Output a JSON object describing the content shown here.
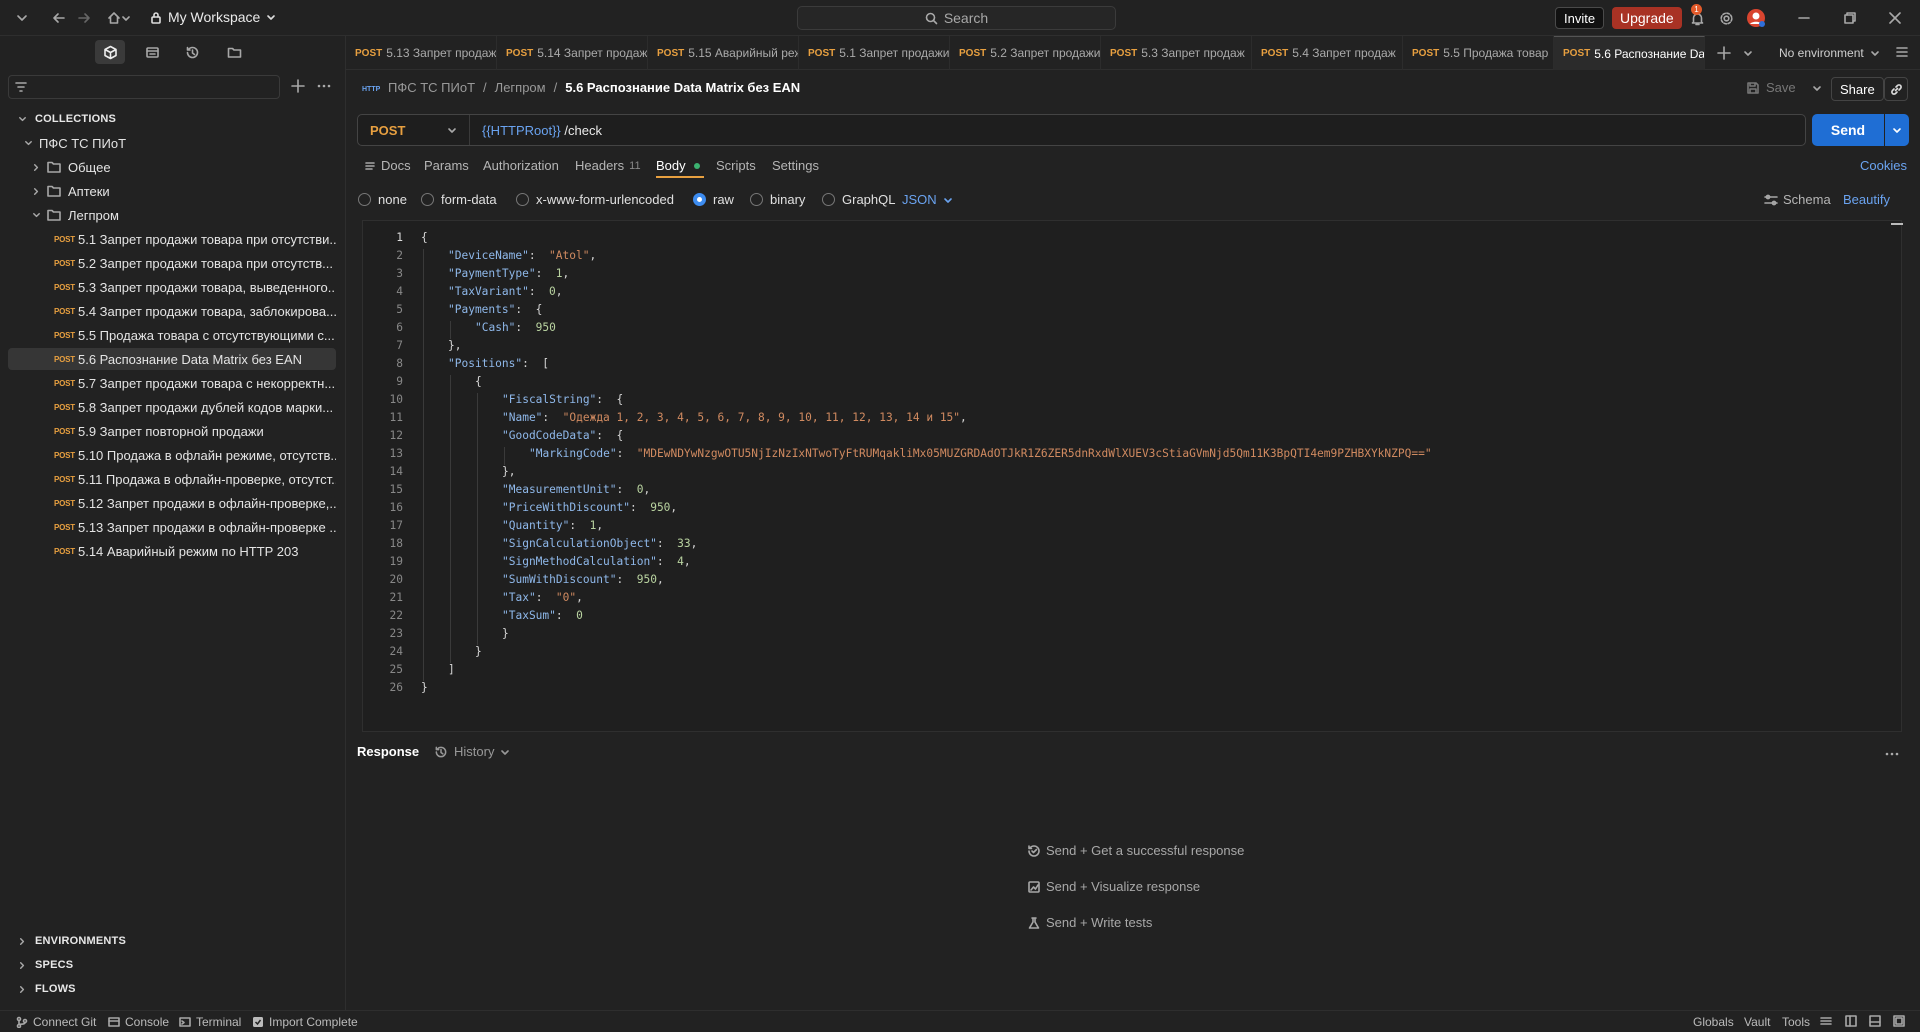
{
  "topbar": {
    "workspace": "My Workspace",
    "search_placeholder": "Search",
    "invite": "Invite",
    "upgrade": "Upgrade",
    "notification_count": "1"
  },
  "sidebar": {
    "collections_label": "COLLECTIONS",
    "collection_name": "ПФС ТС ПИоТ",
    "folders": [
      "Общее",
      "Аптеки",
      "Легпром"
    ],
    "method_tag": "POST",
    "requests": [
      "5.1 Запрет продажи товара при отсутстви...",
      "5.2 Запрет продажи товара при отсутств...",
      "5.3 Запрет продажи товара, выведенного...",
      "5.4 Запрет продажи товара, заблокирова...",
      "5.5 Продажа товара с отсутствующими с...",
      "5.6 Распознание Data Matrix без EAN",
      "5.7 Запрет продажи товара с некорректн...",
      "5.8 Запрет продажи дублей кодов марки...",
      "5.9 Запрет повторной продажи",
      "5.10 Продажа в офлайн режиме, отсутств...",
      "5.11 Продажа в офлайн-проверке, отсутст...",
      "5.12 Запрет продажи в офлайн-проверке,...",
      "5.13 Запрет продажи в офлайн-проверке ...",
      "5.14 Аварийный режим по HTTP 203"
    ],
    "bottom_sections": [
      "ENVIRONMENTS",
      "SPECS",
      "FLOWS"
    ]
  },
  "tabs": [
    {
      "method": "POST",
      "title": "5.13 Запрет продаж"
    },
    {
      "method": "POST",
      "title": "5.14 Запрет продаж"
    },
    {
      "method": "POST",
      "title": "5.15 Аварийный реж"
    },
    {
      "method": "POST",
      "title": "5.1 Запрет продажи"
    },
    {
      "method": "POST",
      "title": "5.2 Запрет продажи"
    },
    {
      "method": "POST",
      "title": "5.3 Запрет продаж"
    },
    {
      "method": "POST",
      "title": "5.4 Запрет продаж"
    },
    {
      "method": "POST",
      "title": "5.5 Продажа товар"
    },
    {
      "method": "POST",
      "title": "5.6 Распознание Da"
    }
  ],
  "environment": "No environment",
  "breadcrumb": {
    "collection": "ПФС ТС ПИоТ",
    "folder": "Легпром",
    "request": "5.6 Распознание Data Matrix без EAN"
  },
  "request": {
    "save": "Save",
    "share": "Share",
    "method": "POST",
    "url_var": "{{HTTPRoot}}",
    "url_path": " /check",
    "send": "Send"
  },
  "request_tabs": {
    "docs": "Docs",
    "params": "Params",
    "authorization": "Authorization",
    "headers": "Headers",
    "headers_count": "11",
    "body": "Body",
    "scripts": "Scripts",
    "settings": "Settings",
    "cookies": "Cookies"
  },
  "body_types": [
    "none",
    "form-data",
    "x-www-form-urlencoded",
    "raw",
    "binary",
    "GraphQL"
  ],
  "body_format": "JSON",
  "schema": "Schema",
  "beautify": "Beautify",
  "code_lines": [
    {
      "indent": 0,
      "parts": [
        [
          "p",
          "{"
        ]
      ]
    },
    {
      "indent": 1,
      "parts": [
        [
          "k",
          "\"DeviceName\""
        ],
        [
          "p",
          ":  "
        ],
        [
          "s",
          "\"Atol\""
        ],
        [
          "p",
          ","
        ]
      ]
    },
    {
      "indent": 1,
      "parts": [
        [
          "k",
          "\"PaymentType\""
        ],
        [
          "p",
          ":  "
        ],
        [
          "n",
          "1"
        ],
        [
          "p",
          ","
        ]
      ]
    },
    {
      "indent": 1,
      "parts": [
        [
          "k",
          "\"TaxVariant\""
        ],
        [
          "p",
          ":  "
        ],
        [
          "n",
          "0"
        ],
        [
          "p",
          ","
        ]
      ]
    },
    {
      "indent": 1,
      "parts": [
        [
          "k",
          "\"Payments\""
        ],
        [
          "p",
          ":  {"
        ]
      ]
    },
    {
      "indent": 2,
      "parts": [
        [
          "k",
          "\"Cash\""
        ],
        [
          "p",
          ":  "
        ],
        [
          "n",
          "950"
        ]
      ]
    },
    {
      "indent": 1,
      "parts": [
        [
          "p",
          "},"
        ]
      ]
    },
    {
      "indent": 1,
      "parts": [
        [
          "k",
          "\"Positions\""
        ],
        [
          "p",
          ":  ["
        ]
      ]
    },
    {
      "indent": 2,
      "parts": [
        [
          "p",
          "{"
        ]
      ]
    },
    {
      "indent": 3,
      "parts": [
        [
          "k",
          "\"FiscalString\""
        ],
        [
          "p",
          ":  {"
        ]
      ]
    },
    {
      "indent": 3,
      "parts": [
        [
          "k",
          "\"Name\""
        ],
        [
          "p",
          ":  "
        ],
        [
          "s",
          "\"Одежда 1, 2, 3, 4, 5, 6, 7, 8, 9, 10, 11, 12, 13, 14 и 15\""
        ],
        [
          "p",
          ","
        ]
      ]
    },
    {
      "indent": 3,
      "parts": [
        [
          "k",
          "\"GoodCodeData\""
        ],
        [
          "p",
          ":  {"
        ]
      ]
    },
    {
      "indent": 4,
      "parts": [
        [
          "k",
          "\"MarkingCode\""
        ],
        [
          "p",
          ":  "
        ],
        [
          "s",
          "\"MDEwNDYwNzgwOTU5NjIzNzIxNTwoTyFtRUMqakliMx05MUZGRDAdOTJkR1Z6ZER5dnRxdWlXUEV3cStiaGVmNjd5Qm11K3BpQTI4em9PZHBXYkNZPQ==\""
        ]
      ]
    },
    {
      "indent": 3,
      "parts": [
        [
          "p",
          "},"
        ]
      ]
    },
    {
      "indent": 3,
      "parts": [
        [
          "k",
          "\"MeasurementUnit\""
        ],
        [
          "p",
          ":  "
        ],
        [
          "n",
          "0"
        ],
        [
          "p",
          ","
        ]
      ]
    },
    {
      "indent": 3,
      "parts": [
        [
          "k",
          "\"PriceWithDiscount\""
        ],
        [
          "p",
          ":  "
        ],
        [
          "n",
          "950"
        ],
        [
          "p",
          ","
        ]
      ]
    },
    {
      "indent": 3,
      "parts": [
        [
          "k",
          "\"Quantity\""
        ],
        [
          "p",
          ":  "
        ],
        [
          "n",
          "1"
        ],
        [
          "p",
          ","
        ]
      ]
    },
    {
      "indent": 3,
      "parts": [
        [
          "k",
          "\"SignCalculationObject\""
        ],
        [
          "p",
          ":  "
        ],
        [
          "n",
          "33"
        ],
        [
          "p",
          ","
        ]
      ]
    },
    {
      "indent": 3,
      "parts": [
        [
          "k",
          "\"SignMethodCalculation\""
        ],
        [
          "p",
          ":  "
        ],
        [
          "n",
          "4"
        ],
        [
          "p",
          ","
        ]
      ]
    },
    {
      "indent": 3,
      "parts": [
        [
          "k",
          "\"SumWithDiscount\""
        ],
        [
          "p",
          ":  "
        ],
        [
          "n",
          "950"
        ],
        [
          "p",
          ","
        ]
      ]
    },
    {
      "indent": 3,
      "parts": [
        [
          "k",
          "\"Tax\""
        ],
        [
          "p",
          ":  "
        ],
        [
          "s",
          "\"0\""
        ],
        [
          "p",
          ","
        ]
      ]
    },
    {
      "indent": 3,
      "parts": [
        [
          "k",
          "\"TaxSum\""
        ],
        [
          "p",
          ":  "
        ],
        [
          "n",
          "0"
        ]
      ]
    },
    {
      "indent": 3,
      "parts": [
        [
          "p",
          "}"
        ]
      ]
    },
    {
      "indent": 2,
      "parts": [
        [
          "p",
          "}"
        ]
      ]
    },
    {
      "indent": 1,
      "parts": [
        [
          "p",
          "]"
        ]
      ]
    },
    {
      "indent": 0,
      "parts": [
        [
          "p",
          "}"
        ]
      ]
    }
  ],
  "response": {
    "title": "Response",
    "history": "History",
    "hints": [
      "Send + Get a successful response",
      "Send + Visualize response",
      "Send + Write tests"
    ]
  },
  "statusbar": {
    "connect_git": "Connect Git",
    "console": "Console",
    "terminal": "Terminal",
    "import_complete": "Import Complete",
    "globals": "Globals",
    "vault": "Vault",
    "tools": "Tools"
  },
  "colors": {
    "accent": "#1f6ed4",
    "upgrade": "#a83224",
    "method_post": "#e8a040",
    "json_key": "#8fb8ea",
    "json_string": "#d08a60",
    "json_number": "#b9d3a0"
  }
}
